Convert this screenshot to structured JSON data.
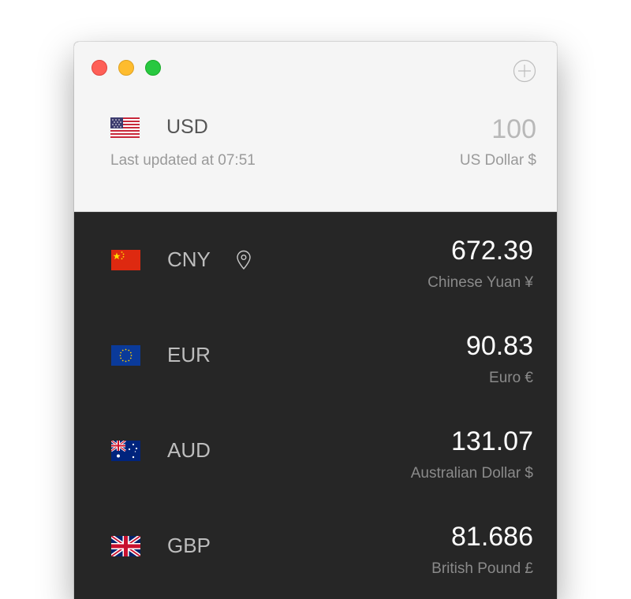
{
  "window": {
    "add_button": "plus-circle-icon"
  },
  "base": {
    "code": "USD",
    "amount": "100",
    "updated": "Last updated at 07:51",
    "name": "US Dollar $",
    "flag": "us-flag-icon"
  },
  "rows": [
    {
      "code": "CNY",
      "value": "672.39",
      "name": "Chinese Yuan ¥",
      "flag": "china-flag-icon",
      "location_icon": "location-pin-icon"
    },
    {
      "code": "EUR",
      "value": "90.83",
      "name": "Euro €",
      "flag": "eu-flag-icon"
    },
    {
      "code": "AUD",
      "value": "131.07",
      "name": "Australian Dollar $",
      "flag": "australia-flag-icon"
    },
    {
      "code": "GBP",
      "value": "81.686",
      "name": "British Pound £",
      "flag": "uk-flag-icon"
    }
  ],
  "colors": {
    "header_bg": "#f5f5f5",
    "list_bg": "#262626",
    "value_text": "#ffffff",
    "secondary_text": "#8a8a8a"
  }
}
